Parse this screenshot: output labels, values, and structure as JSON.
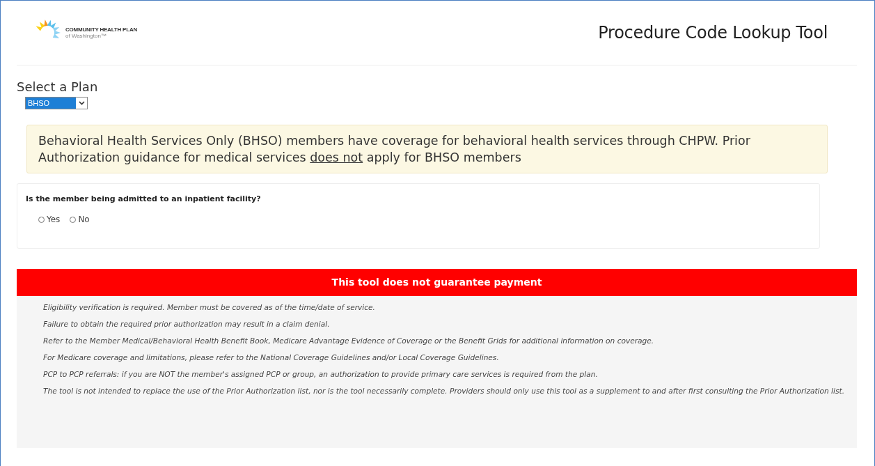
{
  "logo": {
    "name": "COMMUNITY HEALTH PLAN",
    "subtitle": "of Washington™"
  },
  "title": "Procedure Code Lookup Tool",
  "plan": {
    "label": "Select a Plan",
    "value": "BHSO"
  },
  "notice": {
    "before": "Behavioral Health Services Only (BHSO) members have coverage for behavioral health services through CHPW. Prior Authorization guidance for medical services ",
    "underlined": "does not",
    "after": " apply for BHSO members"
  },
  "question": {
    "text": "Is the member being admitted to an inpatient facility?",
    "options": [
      {
        "label": "Yes",
        "selected": false
      },
      {
        "label": "No",
        "selected": false
      }
    ]
  },
  "warning": "This tool does not guarantee payment",
  "disclaimers": [
    "Eligibility verification is required. Member must be covered as of the time/date of service.",
    "Failure to obtain the required prior authorization may result in a claim denial.",
    "Refer to the Member Medical/Behavioral Health Benefit Book, Medicare Advantage Evidence of Coverage or the Benefit Grids for additional information on coverage.",
    "For Medicare coverage and limitations, please refer to the National Coverage Guidelines and/or Local Coverage Guidelines.",
    "PCP to PCP referrals: if you are NOT the member's assigned PCP or group, an authorization to provide primary care services is required from the plan.",
    "The tool is not intended to replace the use of the Prior Authorization list, nor is the tool necessarily complete. Providers should only use this tool as a supplement to and after first consulting the Prior Authorization list."
  ]
}
